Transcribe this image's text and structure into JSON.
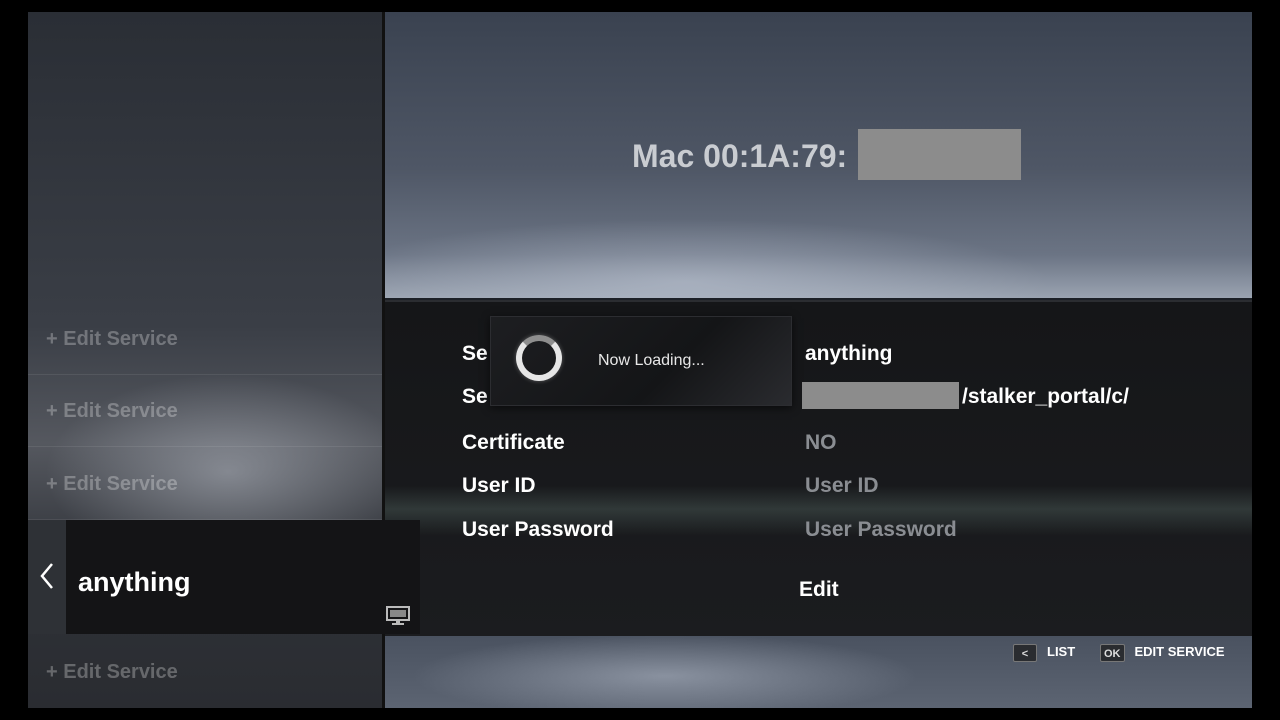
{
  "sidebar": {
    "items": [
      {
        "label": "+ Edit Service"
      },
      {
        "label": "+ Edit Service"
      },
      {
        "label": "+ Edit Service"
      },
      {
        "label": "+ Edit Service"
      }
    ],
    "selected": {
      "label": "anything",
      "icon": "tv-icon",
      "back_icon": "chevron-left-icon"
    }
  },
  "header": {
    "mac_prefix": "Mac 00:1A:79:"
  },
  "details": {
    "rows": [
      {
        "label": "Se",
        "value": "anything"
      },
      {
        "label": "Se",
        "value_suffix": "/stalker_portal/c/"
      },
      {
        "label": "Certificate",
        "value": "NO"
      },
      {
        "label": "User ID",
        "value": "User ID"
      },
      {
        "label": "User Password",
        "value": "User Password"
      }
    ],
    "edit_label": "Edit"
  },
  "loading": {
    "text": "Now Loading..."
  },
  "footer": {
    "hints": [
      {
        "key": "<",
        "label": "LIST"
      },
      {
        "key": "OK",
        "label": "EDIT SERVICE"
      }
    ]
  },
  "colors": {
    "redaction": "#8c8c8c",
    "muted_value": "#8a8d92"
  }
}
